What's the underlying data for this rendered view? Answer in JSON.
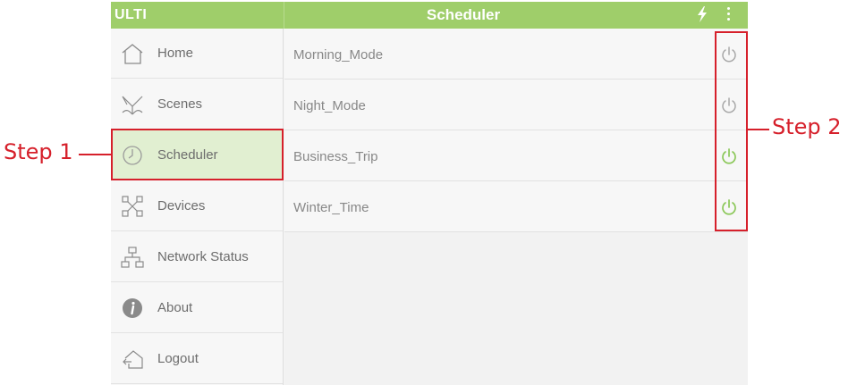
{
  "header": {
    "app_name": "ULTI",
    "title": "Scheduler"
  },
  "sidebar": {
    "items": [
      {
        "label": "Home",
        "icon": "home-icon"
      },
      {
        "label": "Scenes",
        "icon": "scenes-icon"
      },
      {
        "label": "Scheduler",
        "icon": "clock-icon",
        "active": true
      },
      {
        "label": "Devices",
        "icon": "devices-icon"
      },
      {
        "label": "Network Status",
        "icon": "network-icon"
      },
      {
        "label": "About",
        "icon": "info-icon"
      },
      {
        "label": "Logout",
        "icon": "logout-icon"
      }
    ]
  },
  "schedules": [
    {
      "name": "Morning_Mode",
      "enabled": false
    },
    {
      "name": "Night_Mode",
      "enabled": false
    },
    {
      "name": "Business_Trip",
      "enabled": true
    },
    {
      "name": "Winter_Time",
      "enabled": true
    }
  ],
  "annotations": {
    "step1": "Step 1",
    "step2": "Step 2"
  },
  "colors": {
    "header_green": "#9fce6a",
    "power_on": "#8cc85a",
    "power_off": "#a8a8a8",
    "annotation_red": "#d6202b",
    "active_row": "#e1efd1"
  }
}
